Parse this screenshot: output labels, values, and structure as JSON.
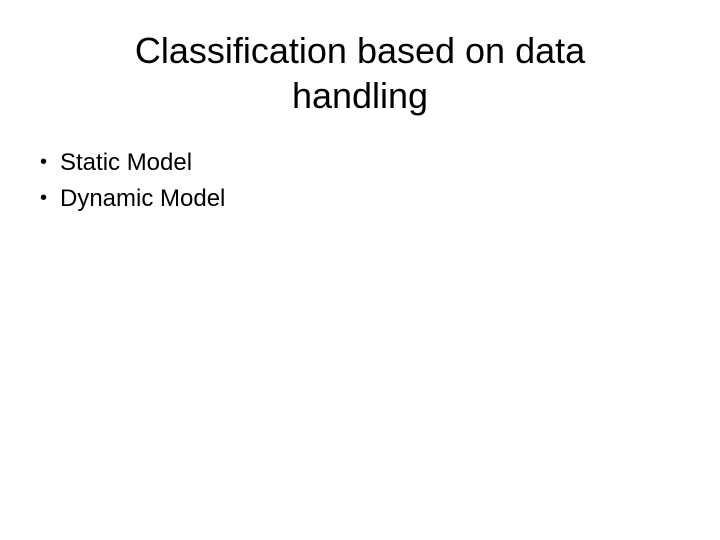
{
  "slide": {
    "title": "Classification based on data handling",
    "bullets": [
      {
        "text": "Static Model"
      },
      {
        "text": "Dynamic Model"
      }
    ]
  }
}
